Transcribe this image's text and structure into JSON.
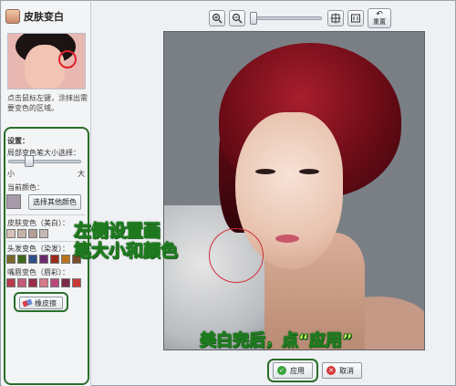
{
  "panel": {
    "title": "皮肤变白",
    "hint": "点击鼠标左键，涂抹出需要变色的区域。",
    "settings_label": "设置：",
    "brush_size_label": "局部变色笔大小选择：",
    "small": "小",
    "large": "大",
    "current_color_label": "当前颜色：",
    "pick_color_button": "选择其他颜色",
    "skin_label": "皮肤变色（美白）：",
    "hair_label": "头发变色（染发）：",
    "lip_label": "嘴唇变色（唇彩）：",
    "eraser_button": "橡皮擦",
    "current_color": "#a79aa8",
    "skin_colors": [
      "#d6c2b8",
      "#c6b3a8",
      "#b49f94",
      "#c3b8b2"
    ],
    "hair_colors": [
      "#7a6a2a",
      "#3f6a1e",
      "#2f4f8a",
      "#6a2a6a",
      "#9a2a1a",
      "#b8741a",
      "#7a4a2a"
    ],
    "lip_colors": [
      "#b83a4a",
      "#c85a7a",
      "#9a2a4a",
      "#d87a8a",
      "#b8487a",
      "#7a2a4a",
      "#c83a3a"
    ]
  },
  "toolbar": {
    "zoom_in_icon": "zoom-in",
    "zoom_out_icon": "zoom-out",
    "fit_icon": "fit-screen",
    "actual_icon": "actual-size",
    "reset_label": "重置",
    "zoom_level": 0
  },
  "annotations": {
    "left_note_line1": "左侧设置画",
    "left_note_line2": "笔大小和颜色",
    "bottom_note": "美白完后，点“应用”"
  },
  "footer": {
    "apply_button": "应用",
    "cancel_button": "取消"
  }
}
